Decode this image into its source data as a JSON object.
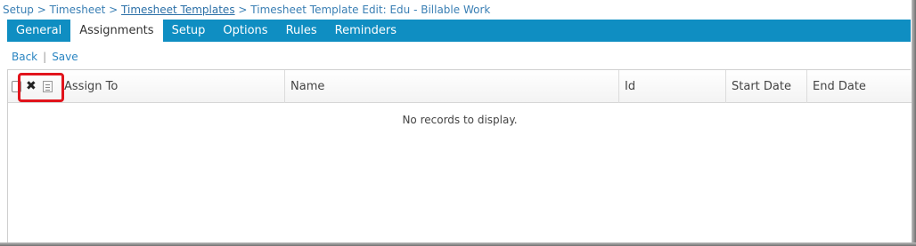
{
  "breadcrumb": {
    "items": [
      {
        "label": "Setup",
        "link": false
      },
      {
        "label": "Timesheet",
        "link": false
      },
      {
        "label": "Timesheet Templates",
        "link": true
      },
      {
        "label": "Timesheet Template Edit: Edu - Billable Work",
        "link": false
      }
    ],
    "separator": ">"
  },
  "tabs": [
    {
      "label": "General",
      "active": false
    },
    {
      "label": "Assignments",
      "active": true
    },
    {
      "label": "Setup",
      "active": false
    },
    {
      "label": "Options",
      "active": false
    },
    {
      "label": "Rules",
      "active": false
    },
    {
      "label": "Reminders",
      "active": false
    }
  ],
  "actions": {
    "back_label": "Back",
    "separator": "|",
    "save_label": "Save"
  },
  "grid": {
    "columns": [
      "Assign To",
      "Name",
      "Id",
      "Start Date",
      "End Date"
    ],
    "empty_message": "No records to display."
  },
  "colors": {
    "tab_bar": "#0f8ec2",
    "link": "#2a85c2",
    "highlight": "#e1141c"
  },
  "icons": {
    "select_all": "checkbox-icon",
    "delete": "delete-x-icon",
    "list": "list-icon"
  }
}
